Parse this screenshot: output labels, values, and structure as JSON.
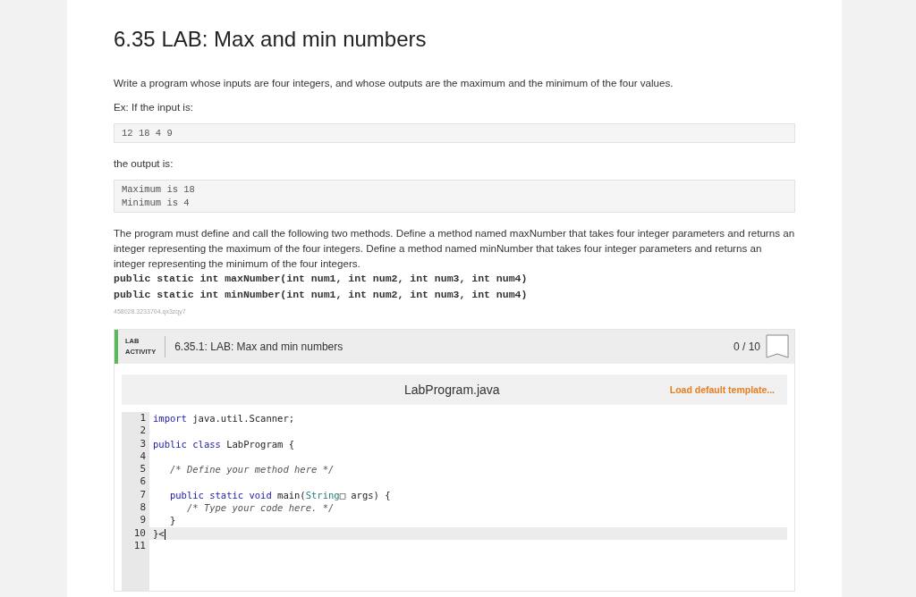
{
  "title": "6.35 LAB: Max and min numbers",
  "intro": "Write a program whose inputs are four integers, and whose outputs are the maximum and the minimum of the four values.",
  "example_label": "Ex: If the input is:",
  "input_lines": [
    "12 18 4 9"
  ],
  "output_label": "the output is:",
  "output_lines": [
    "Maximum is 18",
    "Minimum is 4"
  ],
  "description": "The program must define and call the following two methods. Define a method named maxNumber that takes four integer parameters and returns an integer representing the maximum of the four integers. Define a method named minNumber that takes four integer parameters and returns an integer representing the minimum of the four integers.",
  "signatures": [
    "public static int maxNumber(int num1, int num2, int num3, int num4)",
    "public static int minNumber(int num1, int num2, int num3, int num4)"
  ],
  "id_code": "458028.3233704.qx3zqy7",
  "lab": {
    "badge_line1": "LAB",
    "badge_line2": "ACTIVITY",
    "title": "6.35.1: LAB: Max and min numbers",
    "score": "0 / 10"
  },
  "editor": {
    "filename": "LabProgram.java",
    "load_template": "Load default template...",
    "lines": [
      {
        "number": "1",
        "active": false,
        "tokens": [
          {
            "kind": "keyword",
            "text": "import"
          },
          {
            "kind": "plain",
            "text": " java.util.Scanner;"
          }
        ]
      },
      {
        "number": "2",
        "active": false
      },
      {
        "number": "3",
        "active": false,
        "tokens": [
          {
            "kind": "keyword",
            "text": "public class"
          },
          {
            "kind": "plain",
            "text": " LabProgram {"
          }
        ]
      },
      {
        "number": "4",
        "active": false
      },
      {
        "number": "5",
        "active": false,
        "tokens": [
          {
            "kind": "comment",
            "text": "   /* Define your method here */"
          }
        ]
      },
      {
        "number": "6",
        "active": false
      },
      {
        "number": "7",
        "active": false,
        "tokens": [
          {
            "kind": "keyword",
            "text": "   public static void"
          },
          {
            "kind": "plain",
            "text": " main("
          },
          {
            "kind": "type",
            "text": "String"
          },
          {
            "kind": "plain",
            "text": "□ args) {"
          }
        ]
      },
      {
        "number": "8",
        "active": false,
        "tokens": [
          {
            "kind": "comment",
            "text": "      /* Type your code here. */"
          }
        ]
      },
      {
        "number": "9",
        "active": false,
        "tokens": [
          {
            "kind": "plain",
            "text": "   }"
          }
        ]
      },
      {
        "number": "10",
        "active": true,
        "tokens": [
          {
            "kind": "plain",
            "text": "}<"
          }
        ]
      },
      {
        "number": "11",
        "active": false
      }
    ]
  }
}
